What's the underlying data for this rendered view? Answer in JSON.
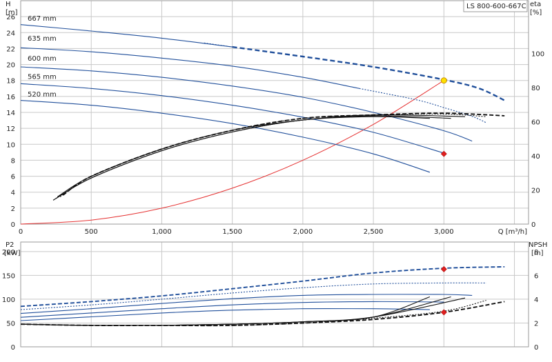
{
  "model_label": "LS 800-600-667C",
  "chart_data": [
    {
      "id": "head",
      "type": "line",
      "ylabel": [
        "H",
        "[m]"
      ],
      "ylabel_right": [
        "eta",
        "[%]"
      ],
      "xlabel": "Q [m³/h]",
      "xlim": [
        0,
        3600
      ],
      "ylim": [
        0,
        28
      ],
      "ylim_right": [
        0,
        131
      ],
      "x_ticks": [
        0,
        500,
        1000,
        1500,
        2000,
        2500,
        3000
      ],
      "x_tick_labels": [
        "0",
        "500",
        "1,000",
        "1,500",
        "2,000",
        "2,500",
        "3,000"
      ],
      "y_ticks": [
        0,
        2,
        4,
        6,
        8,
        10,
        12,
        14,
        16,
        18,
        20,
        22,
        24,
        26
      ],
      "y_tick_labels": [
        "0",
        "2",
        "4",
        "6",
        "8",
        "10",
        "12",
        "14",
        "16",
        "18",
        "20",
        "22",
        "24",
        "26"
      ],
      "y_right_ticks": [
        0,
        20,
        40,
        60,
        80,
        100
      ],
      "y_right_tick_labels": [
        "0",
        "20",
        "40",
        "60",
        "80",
        "100"
      ],
      "grid": true,
      "head_curves": [
        {
          "label": "667 mm",
          "color": "#1f4e9a",
          "label_x": 10,
          "label_y": 25.3,
          "solid": [
            [
              0,
              25.0
            ],
            [
              500,
              24.2
            ],
            [
              1000,
              23.3
            ],
            [
              1500,
              22.2
            ]
          ],
          "dotted": [
            [
              1300,
              22.7
            ],
            [
              1500,
              22.2
            ]
          ],
          "bold_dashed": [
            [
              1500,
              22.2
            ],
            [
              2000,
              21.0
            ],
            [
              2500,
              19.7
            ],
            [
              3000,
              18.1
            ],
            [
              3250,
              17.0
            ],
            [
              3430,
              15.5
            ]
          ]
        },
        {
          "label": "635 mm",
          "color": "#1f4e9a",
          "label_x": 10,
          "label_y": 22.8,
          "solid": [
            [
              0,
              22.1
            ],
            [
              500,
              21.6
            ],
            [
              1000,
              20.8
            ],
            [
              1500,
              19.8
            ],
            [
              2000,
              18.4
            ],
            [
              2400,
              17.0
            ]
          ],
          "dotted": [
            [
              2400,
              17.0
            ],
            [
              2800,
              15.6
            ],
            [
              3000,
              14.6
            ],
            [
              3200,
              13.5
            ],
            [
              3300,
              12.7
            ]
          ]
        },
        {
          "label": "600 mm",
          "color": "#1f4e9a",
          "label_x": 10,
          "label_y": 20.3,
          "solid": [
            [
              0,
              19.7
            ],
            [
              500,
              19.2
            ],
            [
              1000,
              18.4
            ],
            [
              1500,
              17.3
            ],
            [
              2000,
              15.9
            ],
            [
              2500,
              14.0
            ],
            [
              3000,
              11.7
            ],
            [
              3200,
              10.4
            ]
          ]
        },
        {
          "label": "565 mm",
          "color": "#1f4e9a",
          "label_x": 10,
          "label_y": 18.0,
          "solid": [
            [
              0,
              17.6
            ],
            [
              500,
              17.0
            ],
            [
              1000,
              16.1
            ],
            [
              1500,
              14.9
            ],
            [
              2000,
              13.4
            ],
            [
              2500,
              11.5
            ],
            [
              3000,
              8.9
            ]
          ]
        },
        {
          "label": "520 mm",
          "color": "#1f4e9a",
          "label_x": 10,
          "label_y": 15.8,
          "solid": [
            [
              0,
              15.5
            ],
            [
              500,
              14.9
            ],
            [
              1000,
              13.9
            ],
            [
              1500,
              12.6
            ],
            [
              2000,
              10.9
            ],
            [
              2500,
              8.8
            ],
            [
              2900,
              6.5
            ]
          ]
        }
      ],
      "efficiency_curves": [
        {
          "points": [
            [
              230,
              14
            ],
            [
              500,
              27
            ],
            [
              1000,
              43
            ],
            [
              1500,
              54
            ],
            [
              2000,
              61
            ],
            [
              2500,
              63
            ],
            [
              2900,
              62
            ]
          ],
          "style": "solid"
        },
        {
          "points": [
            [
              250,
              15
            ],
            [
              500,
              27
            ],
            [
              1000,
              43
            ],
            [
              1500,
              54
            ],
            [
              2000,
              61
            ],
            [
              2500,
              63.5
            ],
            [
              3050,
              62
            ]
          ],
          "style": "solid"
        },
        {
          "points": [
            [
              260,
              16
            ],
            [
              500,
              28
            ],
            [
              1000,
              44
            ],
            [
              1500,
              55
            ],
            [
              2000,
              61
            ],
            [
              2500,
              64
            ],
            [
              3150,
              63
            ]
          ],
          "style": "solid"
        },
        {
          "points": [
            [
              280,
              16
            ],
            [
              500,
              28
            ],
            [
              1000,
              44
            ],
            [
              1500,
              55
            ],
            [
              2000,
              62
            ],
            [
              2500,
              64
            ],
            [
              3000,
              64.5
            ],
            [
              3300,
              63
            ]
          ],
          "style": "dotted"
        },
        {
          "points": [
            [
              300,
              17
            ],
            [
              500,
              28
            ],
            [
              1000,
              44
            ],
            [
              1500,
              55
            ],
            [
              2000,
              62
            ],
            [
              2500,
              64
            ],
            [
              3000,
              65
            ],
            [
              3430,
              63.5
            ]
          ],
          "style": "dashed"
        }
      ],
      "system_curve": {
        "color": "#e53030",
        "points": [
          [
            0,
            0
          ],
          [
            500,
            0.5
          ],
          [
            1000,
            2.0
          ],
          [
            1500,
            4.5
          ],
          [
            2000,
            8.0
          ],
          [
            2500,
            12.5
          ],
          [
            3000,
            18.0
          ]
        ]
      },
      "duty_point": {
        "x": 3000,
        "y": 18.0,
        "color": "#ffe000",
        "stroke": "#c89000"
      },
      "head_marker": {
        "x": 3000,
        "y": 8.8,
        "color": "#e02020"
      }
    },
    {
      "id": "power_npsh",
      "type": "line",
      "ylabel": [
        "P2",
        "[kW]"
      ],
      "ylabel_right": [
        "NPSH",
        "[m]"
      ],
      "xlim": [
        0,
        3600
      ],
      "ylim": [
        0,
        220
      ],
      "ylim_right": [
        0,
        8.8
      ],
      "y_ticks": [
        0,
        50,
        100,
        150,
        200
      ],
      "y_tick_labels": [
        "0",
        "50",
        "100",
        "150",
        "200"
      ],
      "y_right_ticks": [
        0,
        2,
        4,
        6,
        8
      ],
      "y_right_tick_labels": [
        "0",
        "2",
        "4",
        "6",
        "8"
      ],
      "grid": true,
      "power_curves": [
        {
          "points": [
            [
              0,
              85
            ],
            [
              500,
              95
            ],
            [
              1000,
              107
            ],
            [
              1500,
              122
            ],
            [
              2000,
              138
            ],
            [
              2500,
              155
            ],
            [
              3000,
              165
            ],
            [
              3430,
              168
            ]
          ],
          "style": "dashed"
        },
        {
          "points": [
            [
              0,
              78
            ],
            [
              500,
              88
            ],
            [
              1000,
              100
            ],
            [
              1500,
              113
            ],
            [
              2000,
              124
            ],
            [
              2500,
              132
            ],
            [
              3000,
              134
            ],
            [
              3300,
              134
            ]
          ],
          "style": "dotted"
        },
        {
          "points": [
            [
              0,
              70
            ],
            [
              500,
              80
            ],
            [
              1000,
              91
            ],
            [
              1500,
              101
            ],
            [
              2000,
              108
            ],
            [
              2500,
              110
            ],
            [
              3000,
              110
            ],
            [
              3200,
              108
            ]
          ],
          "style": "solid"
        },
        {
          "points": [
            [
              0,
              62
            ],
            [
              500,
              71
            ],
            [
              1000,
              80
            ],
            [
              1500,
              88
            ],
            [
              2000,
              93
            ],
            [
              2500,
              95
            ],
            [
              3000,
              94
            ]
          ],
          "style": "solid"
        },
        {
          "points": [
            [
              0,
              55
            ],
            [
              500,
              63
            ],
            [
              1000,
              71
            ],
            [
              1500,
              77
            ],
            [
              2000,
              80
            ],
            [
              2500,
              80
            ],
            [
              2900,
              78
            ]
          ],
          "style": "solid"
        }
      ],
      "npsh_curves": [
        {
          "points": [
            [
              0,
              1.9
            ],
            [
              500,
              1.8
            ],
            [
              1000,
              1.8
            ],
            [
              1500,
              1.9
            ],
            [
              2000,
              2.1
            ],
            [
              2500,
              2.5
            ],
            [
              2900,
              4.2
            ]
          ],
          "style": "solid"
        },
        {
          "points": [
            [
              0,
              1.9
            ],
            [
              500,
              1.8
            ],
            [
              1000,
              1.8
            ],
            [
              1500,
              1.9
            ],
            [
              2000,
              2.1
            ],
            [
              2500,
              2.5
            ],
            [
              3050,
              4.2
            ]
          ],
          "style": "solid"
        },
        {
          "points": [
            [
              0,
              1.9
            ],
            [
              500,
              1.8
            ],
            [
              1000,
              1.8
            ],
            [
              1500,
              1.9
            ],
            [
              2000,
              2.1
            ],
            [
              2500,
              2.5
            ],
            [
              3150,
              4.1
            ]
          ],
          "style": "solid"
        },
        {
          "points": [
            [
              0,
              1.9
            ],
            [
              500,
              1.8
            ],
            [
              1000,
              1.8
            ],
            [
              1500,
              1.8
            ],
            [
              2000,
              2.0
            ],
            [
              2500,
              2.4
            ],
            [
              3000,
              3.0
            ],
            [
              3300,
              3.9
            ]
          ],
          "style": "dotted"
        },
        {
          "points": [
            [
              0,
              1.9
            ],
            [
              500,
              1.8
            ],
            [
              1000,
              1.8
            ],
            [
              1500,
              1.8
            ],
            [
              2000,
              2.0
            ],
            [
              2500,
              2.3
            ],
            [
              3000,
              2.9
            ],
            [
              3430,
              3.8
            ]
          ],
          "style": "dashed"
        }
      ],
      "power_marker": {
        "x": 3000,
        "y": 163,
        "color": "#e02020"
      },
      "npsh_marker": {
        "x": 3000,
        "y": 2.9,
        "color": "#e02020"
      }
    }
  ]
}
